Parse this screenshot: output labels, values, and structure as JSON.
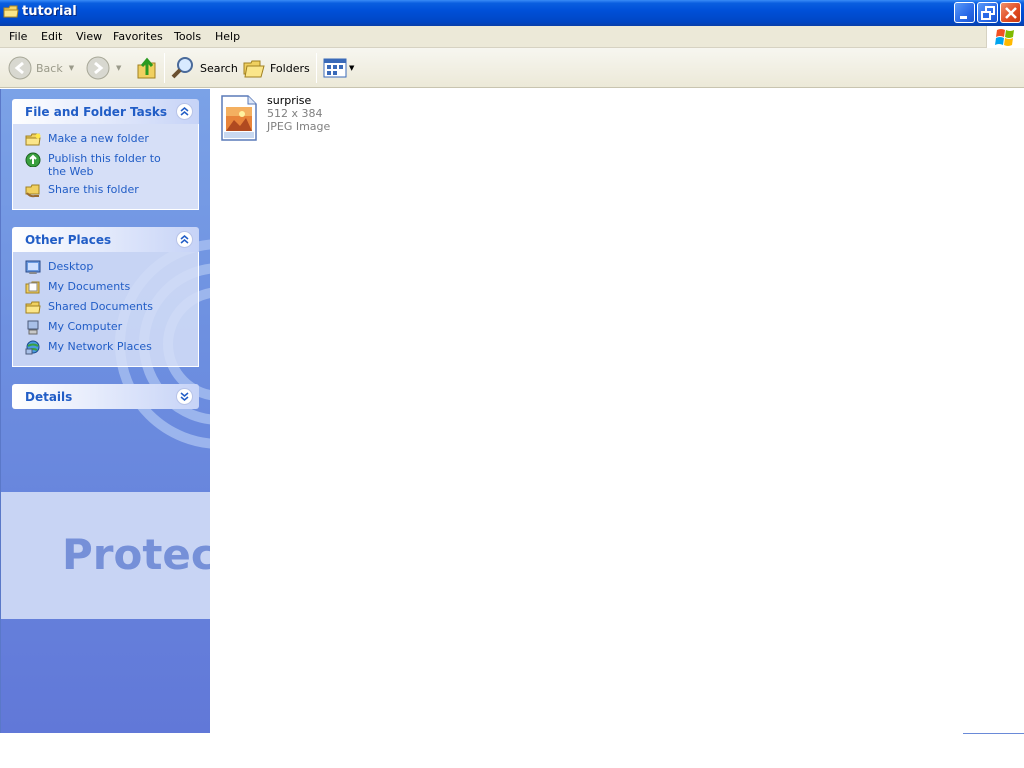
{
  "window": {
    "title": "tutorial"
  },
  "menu": {
    "items": [
      "File",
      "Edit",
      "View",
      "Favorites",
      "Tools",
      "Help"
    ]
  },
  "toolbar": {
    "back_label": "Back",
    "search_label": "Search",
    "folders_label": "Folders",
    "icons": [
      "back-arrow-icon",
      "forward-arrow-icon",
      "up-folder-icon",
      "search-icon",
      "folders-icon",
      "views-icon"
    ]
  },
  "tasks_panel": {
    "title": "File and Folder Tasks",
    "items": [
      {
        "label": "Make a new folder",
        "icon": "new-folder-icon"
      },
      {
        "label": "Publish this folder to the Web",
        "icon": "publish-web-icon"
      },
      {
        "label": "Share this folder",
        "icon": "share-folder-icon"
      }
    ]
  },
  "places_panel": {
    "title": "Other Places",
    "items": [
      {
        "label": "Desktop",
        "icon": "desktop-icon"
      },
      {
        "label": "My Documents",
        "icon": "my-documents-icon"
      },
      {
        "label": "Shared Documents",
        "icon": "shared-documents-icon"
      },
      {
        "label": "My Computer",
        "icon": "my-computer-icon"
      },
      {
        "label": "My Network Places",
        "icon": "network-places-icon"
      }
    ]
  },
  "details_panel": {
    "title": "Details"
  },
  "watermark": {
    "text": "Protec"
  },
  "files": [
    {
      "name": "surprise",
      "dimensions": "512 x 384",
      "type": "JPEG Image",
      "icon": "jpeg-image-icon"
    }
  ],
  "colors": {
    "titlebar": "#0050d8",
    "menubar": "#ece9d8",
    "taskpane": "#6d8fe0",
    "panel_title": "#215dc6",
    "panel_body": "#d6dff7"
  }
}
